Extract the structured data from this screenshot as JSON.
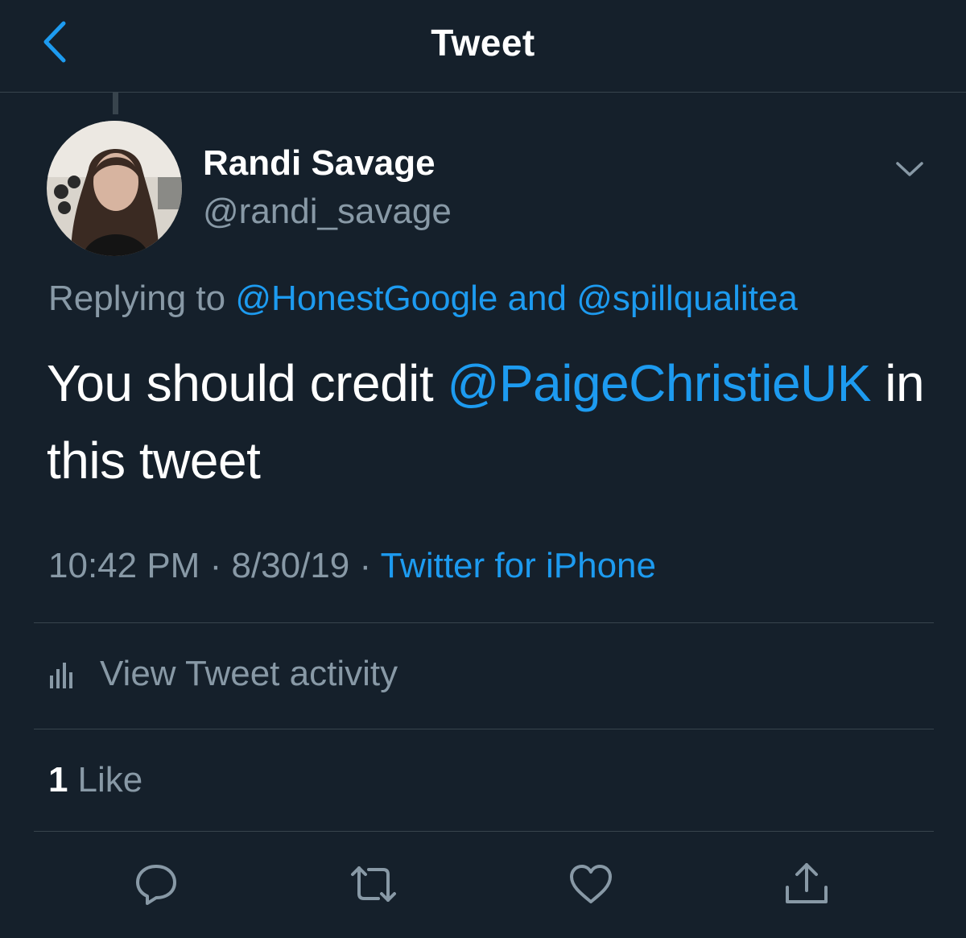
{
  "header": {
    "title": "Tweet",
    "back_icon": "chevron-left-icon"
  },
  "tweet": {
    "author": {
      "display_name": "Randi Savage",
      "handle": "@randi_savage"
    },
    "replying": {
      "prefix": "Replying to",
      "mention_1": "@HonestGoogle",
      "conjunction": "and",
      "mention_2": "@spillqualitea"
    },
    "text": {
      "before": "You should credit",
      "mention": "@PaigeChristieUK",
      "after": "in this tweet"
    },
    "meta": {
      "time": "10:42 PM",
      "separator": "·",
      "date": "8/30/19",
      "source": "Twitter for iPhone"
    },
    "activity_label": "View Tweet activity",
    "likes": {
      "count": "1",
      "label": "Like"
    }
  },
  "actions": [
    "reply-icon",
    "retweet-icon",
    "like-icon",
    "share-icon"
  ],
  "colors": {
    "background": "#15202b",
    "accent": "#1d9bf0",
    "secondary_text": "#8899a6",
    "divider": "#38444d"
  }
}
